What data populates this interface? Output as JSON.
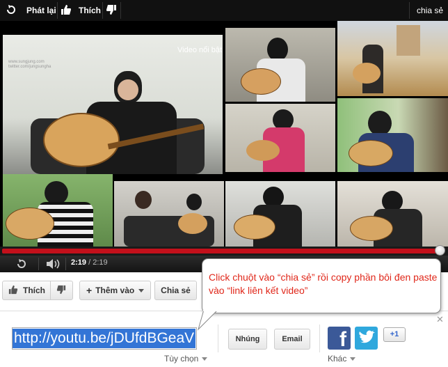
{
  "topbar": {
    "replay_label": "Phát lại",
    "like_label": "Thích",
    "share_label": "chia sẻ"
  },
  "video": {
    "featured_label": "Video nổi bật",
    "watermark_lines": [
      "www.sungjung.com",
      "twitter.com/jungsungha"
    ]
  },
  "player": {
    "current_time": "2:19",
    "separator": "/",
    "total_time": "2:19",
    "progress": 1.0
  },
  "actions": {
    "like_label": "Thích",
    "add_to_label": "Thêm vào",
    "share_label": "Chia sẻ"
  },
  "share": {
    "url": "http://youtu.be/jDUfdBGeaV",
    "options_label": "Tùy chọn",
    "embed_label": "Nhúng",
    "email_label": "Email",
    "more_label": "Khác",
    "gplus_label": "+1"
  },
  "callout": {
    "text": "Click chuột vào “chia sẻ” rồi copy phần bôi đen paste vào “link liên kết video”"
  },
  "colors": {
    "progress": "#c3101b",
    "selection": "#3375d6",
    "callout_text": "#e0271a",
    "facebook": "#3b5998",
    "twitter": "#2fa8dd"
  }
}
